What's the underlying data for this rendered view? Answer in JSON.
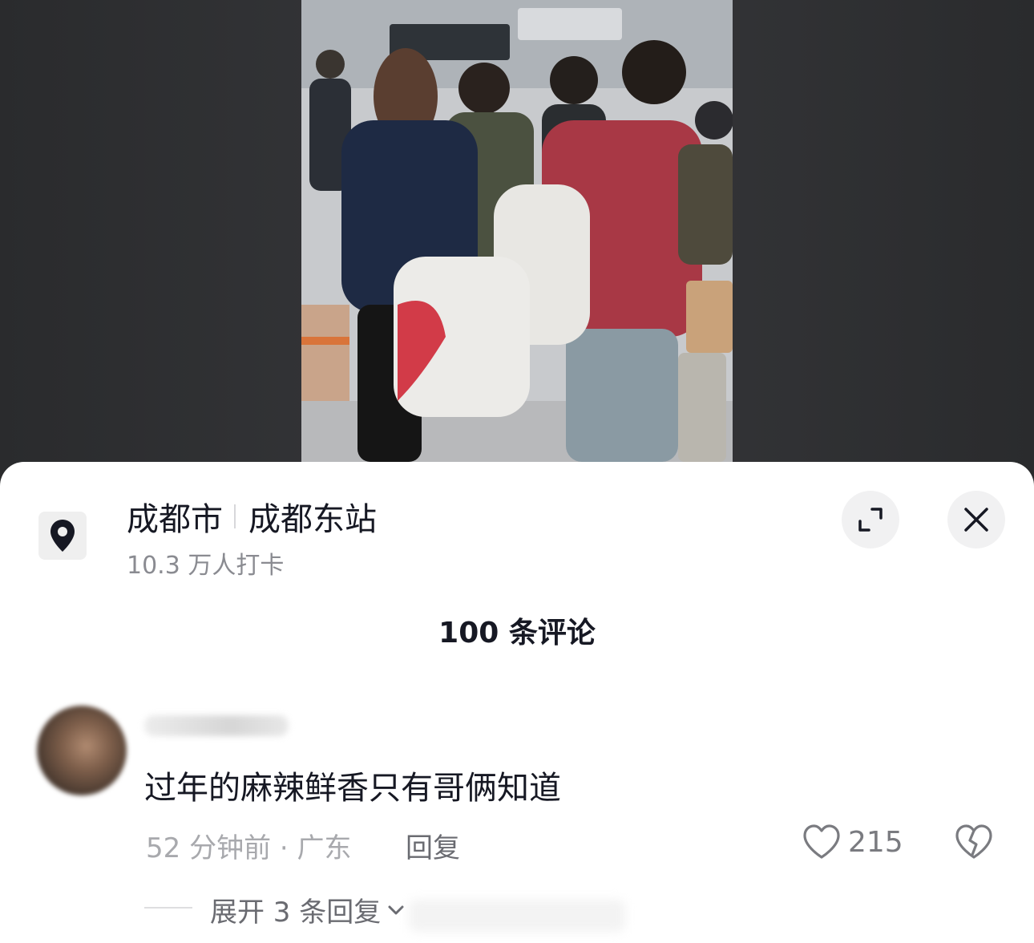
{
  "location": {
    "city": "成都市",
    "place": "成都东站",
    "checkins": "10.3 万人打卡"
  },
  "comments": {
    "header": "100 条评论",
    "items": [
      {
        "text": "过年的麻辣鲜香只有哥俩知道",
        "meta": "52 分钟前 · 广东",
        "reply_label": "回复",
        "likes": "215",
        "expand_label": "展开 3 条回复"
      }
    ]
  },
  "icons": {
    "location": "location-pin-icon",
    "expand": "expand-icon",
    "close": "close-icon",
    "like": "heart-outline-icon",
    "dislike": "broken-heart-icon",
    "chevron": "chevron-down-icon"
  },
  "colors": {
    "text_primary": "#161823",
    "text_secondary": "#8a8b91",
    "backdrop": "#333437",
    "button_bg": "#f1f1f2"
  }
}
